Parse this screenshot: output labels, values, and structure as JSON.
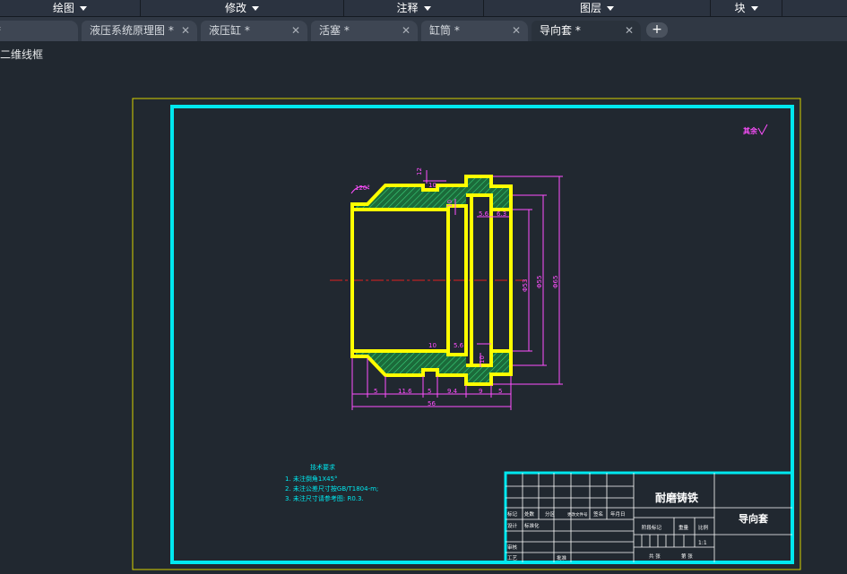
{
  "ribbon": {
    "panels": [
      {
        "label": "绘图"
      },
      {
        "label": "修改"
      },
      {
        "label": "注释"
      },
      {
        "label": "图层"
      },
      {
        "label": "块"
      }
    ]
  },
  "tabs": [
    {
      "label": "液压系统原理图 *"
    },
    {
      "label": "液压缸 *"
    },
    {
      "label": "活塞 *"
    },
    {
      "label": "缸筒 *"
    },
    {
      "label": "导向套 *",
      "active": true
    }
  ],
  "tab_partial_text": "*",
  "new_tab_symbol": "+",
  "close_symbol": "✕",
  "viewport_label": "二维线框",
  "drawing": {
    "surface_roughness": "其余",
    "dims": {
      "d12": "12",
      "d10": "10",
      "angle": "120°",
      "d10b": "10",
      "d56": "5.6",
      "d63": "6.3",
      "phi1": "Φ53",
      "phi2": "Φ55",
      "phi3": "Φ65",
      "d10c": "10",
      "d56b": "5.6",
      "d10d": "10",
      "dim5a": "5",
      "dim116": "11.6",
      "dim5b": "5",
      "dim94": "9.4",
      "dim9": "9",
      "dim5c": "5",
      "total": "56"
    },
    "tech_req": {
      "title": "技术要求",
      "items": [
        "1. 未注倒角1X45°",
        "2. 未注公差尺寸按GB/T1804-m;",
        "3. 未注尺寸请参考图: R0.3."
      ]
    },
    "title_block": {
      "material": "耐磨铸铁",
      "part_name": "导向套",
      "scale": "1:1",
      "labels": [
        "标记",
        "处数",
        "分区",
        "更改文件号",
        "签名",
        "年月日",
        "设计",
        "标准化",
        "阶段标记",
        "重量",
        "比例",
        "审核",
        "工艺",
        "批准",
        "共 张",
        "第 张"
      ]
    }
  }
}
